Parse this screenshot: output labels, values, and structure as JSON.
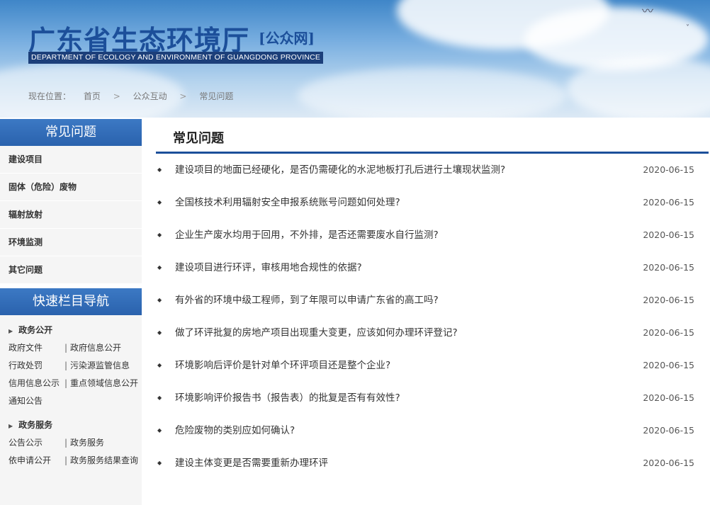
{
  "header": {
    "title": "广东省生态环境厅",
    "tag": "[公众网]",
    "english": "DEPARTMENT OF ECOLOGY AND ENVIRONMENT OF GUANGDONG PROVINCE"
  },
  "breadcrumb": {
    "label": "现在位置：",
    "items": [
      "首页",
      "公众互动",
      "常见问题"
    ],
    "separator": ">"
  },
  "sidebar": {
    "title": "常见问题",
    "items": [
      "建设项目",
      "固体（危险）废物",
      "辐射放射",
      "环境监测",
      "其它问题"
    ],
    "quick_title": "快速栏目导航",
    "groups": [
      {
        "title": "政务公开",
        "links": [
          [
            "政府文件",
            "政府信息公开"
          ],
          [
            "行政处罚",
            "污染源监管信息"
          ],
          [
            "信用信息公示",
            "重点领域信息公开"
          ],
          [
            "通知公告",
            ""
          ]
        ]
      },
      {
        "title": "政务服务",
        "links": [
          [
            "公告公示",
            "政务服务"
          ],
          [
            "依申请公开",
            "政务服务结果查询"
          ]
        ]
      }
    ]
  },
  "main": {
    "title": "常见问题",
    "faqs": [
      {
        "q": "建设项目的地面已经硬化，是否仍需硬化的水泥地板打孔后进行土壤现状监测?",
        "d": "2020-06-15"
      },
      {
        "q": "全国核技术利用辐射安全申报系统账号问题如何处理?",
        "d": "2020-06-15"
      },
      {
        "q": "企业生产废水均用于回用，不外排，是否还需要废水自行监测?",
        "d": "2020-06-15"
      },
      {
        "q": "建设项目进行环评，审核用地合规性的依据?",
        "d": "2020-06-15"
      },
      {
        "q": "有外省的环境中级工程师，到了年限可以申请广东省的高工吗?",
        "d": "2020-06-15"
      },
      {
        "q": "做了环评批复的房地产项目出现重大变更，应该如何办理环评登记?",
        "d": "2020-06-15"
      },
      {
        "q": "环境影响后评价是针对单个环评项目还是整个企业?",
        "d": "2020-06-15"
      },
      {
        "q": "环境影响评价报告书（报告表）的批复是否有有效性?",
        "d": "2020-06-15"
      },
      {
        "q": "危险废物的类别应如何确认?",
        "d": "2020-06-15"
      },
      {
        "q": "建设主体变更是否需要重新办理环评",
        "d": "2020-06-15"
      }
    ]
  },
  "icons": {
    "bullet": "diamond-bullet-icon",
    "group": "triangle-right-icon",
    "bird": "bird-icon"
  },
  "colors": {
    "brand": "#1c4f9a",
    "sidebar_head": "#2f6cb8",
    "sidebar_bg": "#f5f5f5"
  }
}
